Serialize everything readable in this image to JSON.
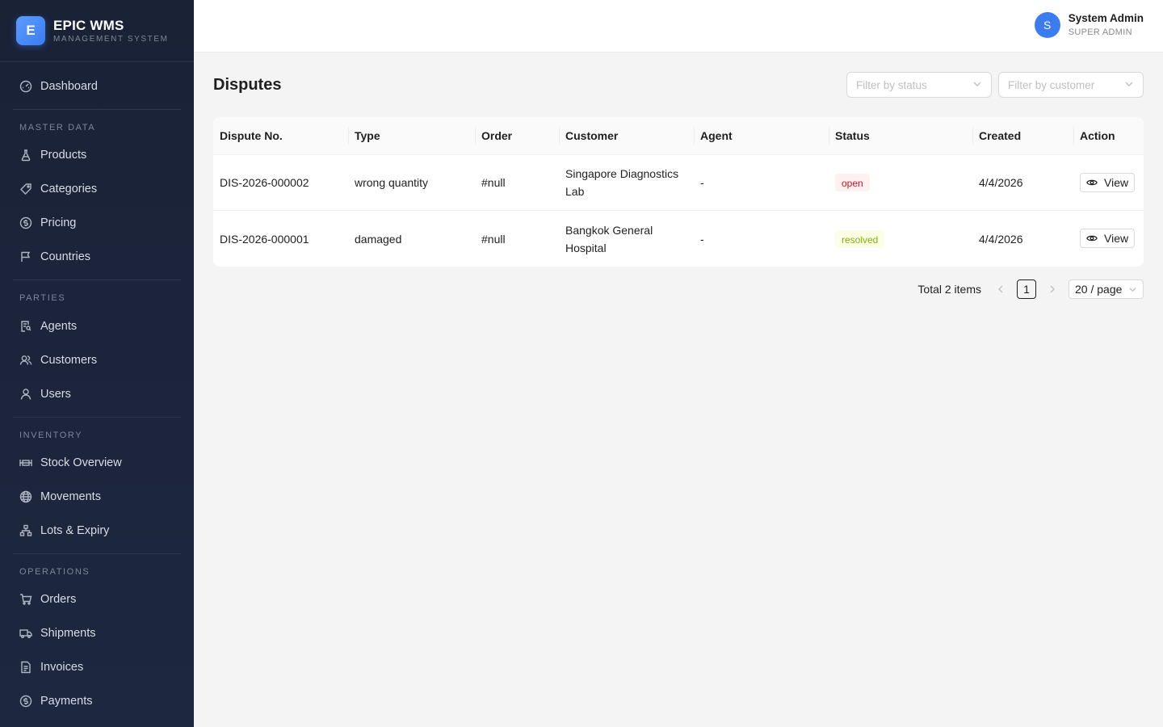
{
  "brand": {
    "logo_letter": "E",
    "title": "EPIC WMS",
    "subtitle": "MANAGEMENT SYSTEM"
  },
  "sidebar": {
    "dashboard": {
      "label": "Dashboard",
      "icon": "dashboard-icon"
    },
    "sections": [
      {
        "title": "MASTER DATA",
        "items": [
          {
            "label": "Products",
            "icon": "flask-icon"
          },
          {
            "label": "Categories",
            "icon": "tag-icon"
          },
          {
            "label": "Pricing",
            "icon": "dollar-icon"
          },
          {
            "label": "Countries",
            "icon": "flag-icon"
          }
        ]
      },
      {
        "title": "PARTIES",
        "items": [
          {
            "label": "Agents",
            "icon": "agent-icon"
          },
          {
            "label": "Customers",
            "icon": "team-icon"
          },
          {
            "label": "Users",
            "icon": "user-icon"
          }
        ]
      },
      {
        "title": "INVENTORY",
        "items": [
          {
            "label": "Stock Overview",
            "icon": "stock-icon"
          },
          {
            "label": "Movements",
            "icon": "globe-icon"
          },
          {
            "label": "Lots & Expiry",
            "icon": "cluster-icon"
          }
        ]
      },
      {
        "title": "OPERATIONS",
        "items": [
          {
            "label": "Orders",
            "icon": "cart-icon"
          },
          {
            "label": "Shipments",
            "icon": "truck-icon"
          },
          {
            "label": "Invoices",
            "icon": "file-icon"
          },
          {
            "label": "Payments",
            "icon": "dollar-icon"
          }
        ]
      }
    ]
  },
  "header": {
    "avatar_letter": "S",
    "user_name": "System Admin",
    "user_role": "SUPER ADMIN"
  },
  "page": {
    "title": "Disputes",
    "filter_status_placeholder": "Filter by status",
    "filter_customer_placeholder": "Filter by customer"
  },
  "table": {
    "columns": [
      "Dispute No.",
      "Type",
      "Order",
      "Customer",
      "Agent",
      "Status",
      "Created",
      "Action"
    ],
    "rows": [
      {
        "dispute_no": "DIS-2026-000002",
        "type": "wrong quantity",
        "order": "#null",
        "customer": "Singapore Diagnostics Lab",
        "agent": "-",
        "status": "open",
        "created": "4/4/2026",
        "action": "View"
      },
      {
        "dispute_no": "DIS-2026-000001",
        "type": "damaged",
        "order": "#null",
        "customer": "Bangkok General Hospital",
        "agent": "-",
        "status": "resolved",
        "created": "4/4/2026",
        "action": "View"
      }
    ]
  },
  "pagination": {
    "total_text": "Total 2 items",
    "current_page": "1",
    "page_size": "20 / page"
  },
  "colors": {
    "sidebar_bg": "#1a2236",
    "accent": "#3b7cf0",
    "open_tag": "#cf1322",
    "resolved_tag": "#7cb305"
  }
}
